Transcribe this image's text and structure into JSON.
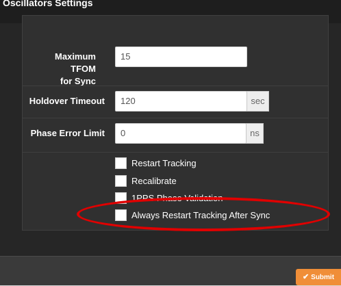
{
  "modal": {
    "title": "Oscillators Settings"
  },
  "fields": {
    "max_tfom": {
      "label_line1": "Maximum TFOM",
      "label_line2": "for Sync",
      "value": "15"
    },
    "holdover": {
      "label": "Holdover Timeout",
      "value": "120",
      "unit": "sec"
    },
    "phase_error": {
      "label": "Phase Error Limit",
      "value": "0",
      "unit": "ns"
    }
  },
  "options": [
    {
      "label": "Restart Tracking",
      "checked": false
    },
    {
      "label": "Recalibrate",
      "checked": false
    },
    {
      "label": "1PPS Phase Validation",
      "checked": false
    },
    {
      "label": "Always Restart Tracking After Sync",
      "checked": false
    }
  ],
  "footer": {
    "submit_label": "Submit"
  },
  "colors": {
    "accent": "#f08e38",
    "highlight": "#e00000"
  },
  "icons": {
    "submit": "checkmark-icon"
  }
}
